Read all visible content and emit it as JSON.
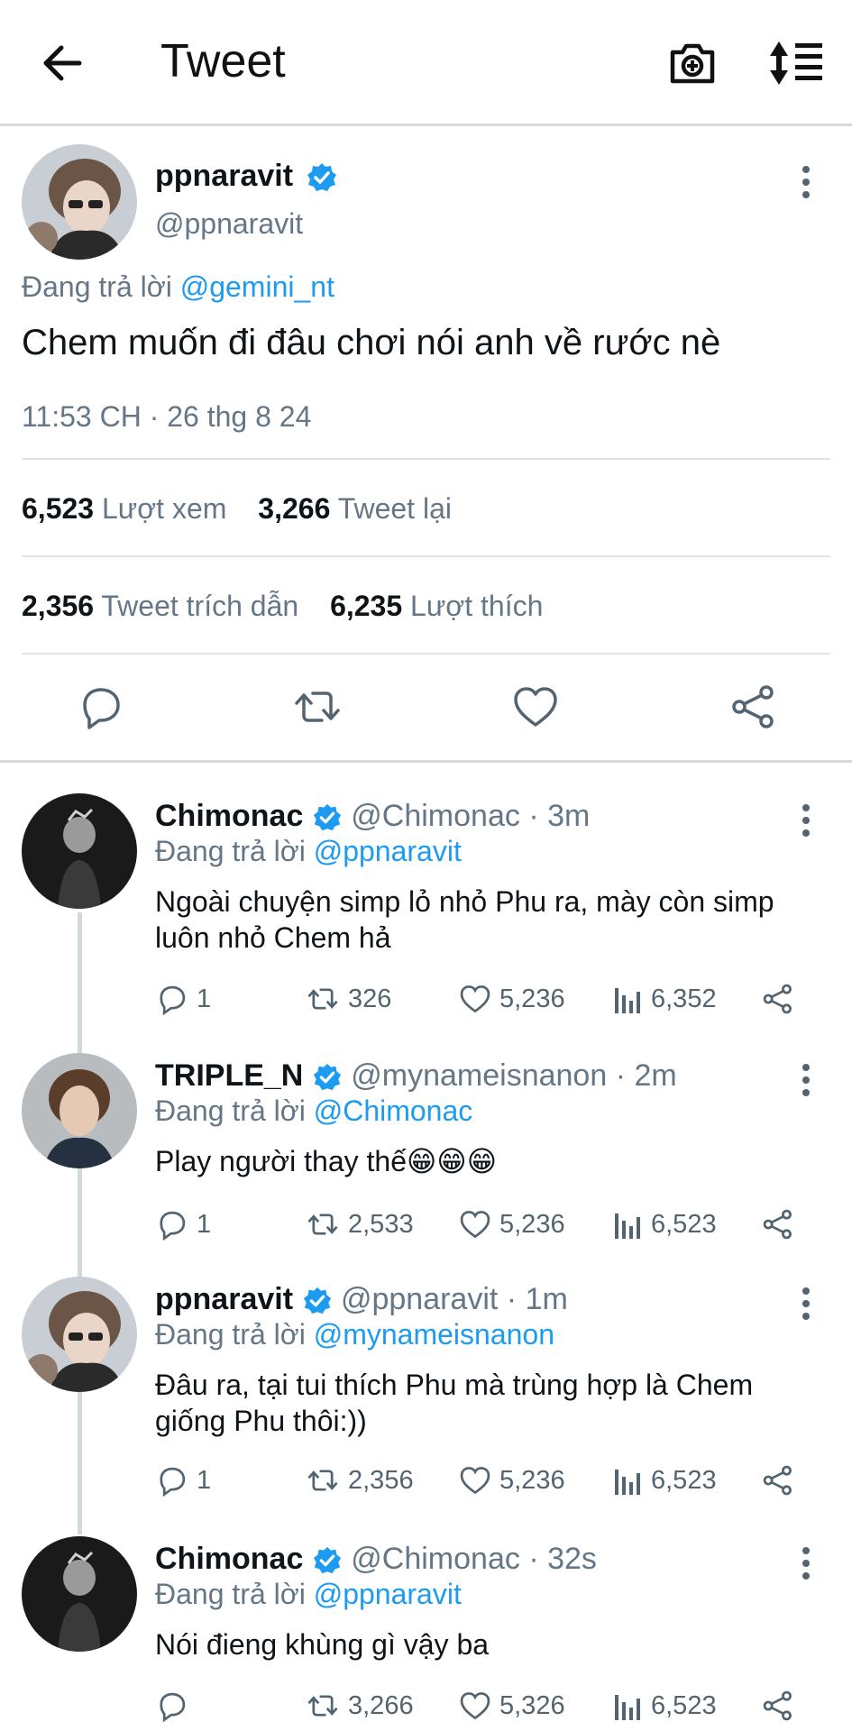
{
  "header": {
    "title": "Tweet",
    "back_icon": "arrow-left-icon",
    "camera_icon": "camera-plus-icon",
    "sort_icon": "sort-icon"
  },
  "tweet": {
    "name": "ppnaravit",
    "handle": "@ppnaravit",
    "replying_prefix": "Đang trả lời",
    "replying_to": "@gemini_nt",
    "text": "Chem muốn đi đâu chơi nói anh về rước nè",
    "timestamp": "11:53 CH · 26 thg 8 24",
    "stats": {
      "views_count": "6,523",
      "views_label": "Lượt xem",
      "retweets_count": "3,266",
      "retweets_label": "Tweet lại",
      "quotes_count": "2,356",
      "quotes_label": "Tweet trích dẫn",
      "likes_count": "6,235",
      "likes_label": "Lượt thích"
    }
  },
  "replies": [
    {
      "name": "Chimonac",
      "handle": "@Chimonac",
      "time": "· 3m",
      "replying_prefix": "Đang trả lời",
      "replying_to": "@ppnaravit",
      "text": "Ngoài chuyện simp lỏ nhỏ Phu ra, mày còn simp luôn nhỏ Chem hả",
      "replies": "1",
      "retweets": "326",
      "likes": "5,236",
      "views": "6,352"
    },
    {
      "name": "TRIPLE_N",
      "handle": "@mynameisnanon",
      "time": "· 2m",
      "replying_prefix": "Đang trả lời",
      "replying_to": "@Chimonac",
      "text": "Play người thay thế😁😁😁",
      "replies": "1",
      "retweets": "2,533",
      "likes": "5,236",
      "views": "6,523"
    },
    {
      "name": "ppnaravit",
      "handle": "@ppnaravit",
      "time": "· 1m",
      "replying_prefix": "Đang trả lời",
      "replying_to": "@mynameisnanon",
      "text": "Đâu ra, tại tui thích Phu mà trùng hợp là Chem giống Phu thôi:))",
      "replies": "1",
      "retweets": "2,356",
      "likes": "5,236",
      "views": "6,523"
    },
    {
      "name": "Chimonac",
      "handle": "@Chimonac",
      "time": "· 32s",
      "replying_prefix": "Đang trả lời",
      "replying_to": "@ppnaravit",
      "text": "Nói đieng khùng gì vậy ba",
      "replies": "",
      "retweets": "3,266",
      "likes": "5,326",
      "views": "6,523"
    }
  ],
  "colors": {
    "link": "#1d9bf0",
    "muted": "#657786",
    "verified": "#1d9bf0"
  }
}
